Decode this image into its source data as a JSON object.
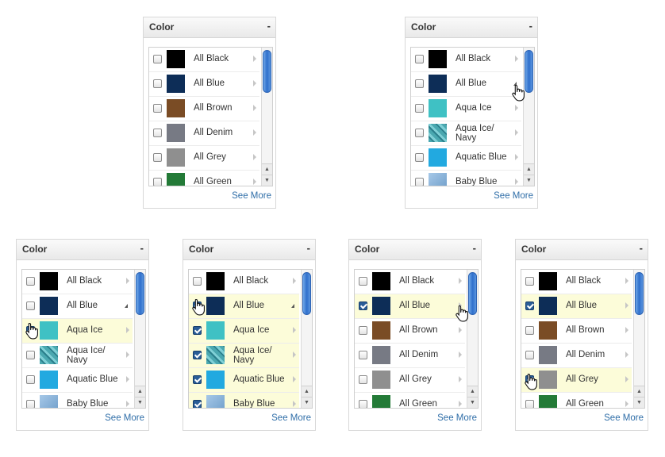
{
  "panels": [
    {
      "title": "Color",
      "collapse": "-",
      "see_more": "See More",
      "items": [
        {
          "label": "All Black",
          "color": "#000000",
          "checked": false
        },
        {
          "label": "All Blue",
          "color": "#0d2d57",
          "checked": false
        },
        {
          "label": "All Brown",
          "color": "#7a4c25",
          "checked": false
        },
        {
          "label": "All Denim",
          "color": "#777a84",
          "checked": false
        },
        {
          "label": "All Grey",
          "color": "#8f8f8f",
          "checked": false
        },
        {
          "label": "All Green",
          "color": "#237a37",
          "checked": false
        }
      ]
    },
    {
      "title": "Color",
      "collapse": "-",
      "see_more": "See More",
      "items": [
        {
          "label": "All Black",
          "color": "#000000",
          "checked": false
        },
        {
          "label": "All Blue",
          "color": "#0d2d57",
          "checked": false,
          "expanded": true
        },
        {
          "label": "Aqua Ice",
          "color": "#3fc1c4",
          "checked": false
        },
        {
          "label": "Aqua Ice/ Navy",
          "color": "#4aa8b0",
          "checked": false,
          "pattern": true
        },
        {
          "label": "Aquatic Blue",
          "color": "#22a9e0",
          "checked": false
        },
        {
          "label": "Baby Blue",
          "color": "#8fb8de",
          "checked": false
        }
      ]
    },
    {
      "title": "Color",
      "collapse": "-",
      "see_more": "See More",
      "items": [
        {
          "label": "All Black",
          "color": "#000000",
          "checked": false
        },
        {
          "label": "All Blue",
          "color": "#0d2d57",
          "checked": false,
          "expanded": true
        },
        {
          "label": "Aqua Ice",
          "color": "#3fc1c4",
          "checked": true,
          "highlight": true
        },
        {
          "label": "Aqua Ice/ Navy",
          "color": "#4aa8b0",
          "checked": false,
          "pattern": true
        },
        {
          "label": "Aquatic Blue",
          "color": "#22a9e0",
          "checked": false
        },
        {
          "label": "Baby Blue",
          "color": "#8fb8de",
          "checked": false
        }
      ]
    },
    {
      "title": "Color",
      "collapse": "-",
      "see_more": "See More",
      "items": [
        {
          "label": "All Black",
          "color": "#000000",
          "checked": false
        },
        {
          "label": "All Blue",
          "color": "#0d2d57",
          "checked": true,
          "highlight": true,
          "expanded": true
        },
        {
          "label": "Aqua Ice",
          "color": "#3fc1c4",
          "checked": true,
          "highlight": true
        },
        {
          "label": "Aqua Ice/ Navy",
          "color": "#4aa8b0",
          "checked": true,
          "highlight": true,
          "pattern": true
        },
        {
          "label": "Aquatic Blue",
          "color": "#22a9e0",
          "checked": true,
          "highlight": true
        },
        {
          "label": "Baby Blue",
          "color": "#8fb8de",
          "checked": true,
          "highlight": true
        }
      ]
    },
    {
      "title": "Color",
      "collapse": "-",
      "see_more": "See More",
      "items": [
        {
          "label": "All Black",
          "color": "#000000",
          "checked": false
        },
        {
          "label": "All Blue",
          "color": "#0d2d57",
          "checked": true,
          "highlight": true
        },
        {
          "label": "All Brown",
          "color": "#7a4c25",
          "checked": false
        },
        {
          "label": "All Denim",
          "color": "#777a84",
          "checked": false
        },
        {
          "label": "All Grey",
          "color": "#8f8f8f",
          "checked": false
        },
        {
          "label": "All Green",
          "color": "#237a37",
          "checked": false
        }
      ]
    },
    {
      "title": "Color",
      "collapse": "-",
      "see_more": "See More",
      "items": [
        {
          "label": "All Black",
          "color": "#000000",
          "checked": false
        },
        {
          "label": "All Blue",
          "color": "#0d2d57",
          "checked": true,
          "highlight": true
        },
        {
          "label": "All Brown",
          "color": "#7a4c25",
          "checked": false
        },
        {
          "label": "All Denim",
          "color": "#777a84",
          "checked": false
        },
        {
          "label": "All Grey",
          "color": "#8f8f8f",
          "checked": true,
          "highlight": true
        },
        {
          "label": "All Green",
          "color": "#237a37",
          "checked": false
        }
      ]
    }
  ]
}
